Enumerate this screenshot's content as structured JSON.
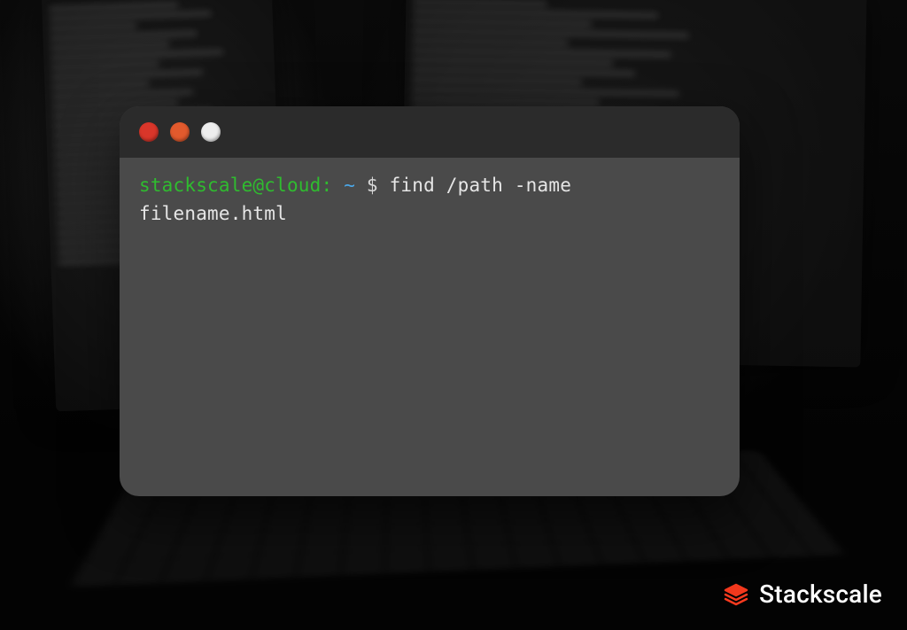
{
  "terminal": {
    "prompt": {
      "user_host": "stackscale@cloud:",
      "cwd": "~",
      "symbol": "$"
    },
    "command": "find /path -name filename.html"
  },
  "brand": {
    "name": "Stackscale"
  },
  "window_controls": {
    "close": "close",
    "minimize": "minimize",
    "zoom": "zoom"
  }
}
